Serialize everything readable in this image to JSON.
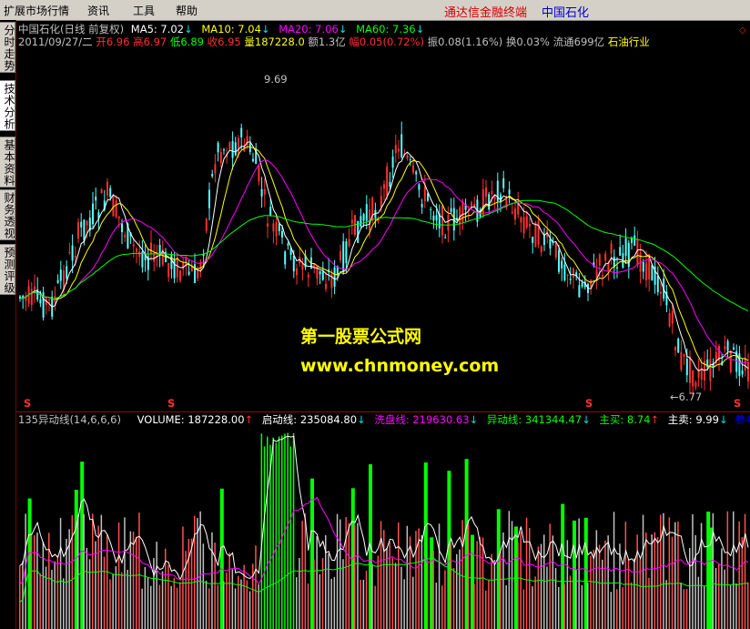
{
  "menu": {
    "items": [
      "扩展市场行情",
      "资讯",
      "工具",
      "帮助"
    ],
    "brand": "通达信金融终端",
    "stock_name": "中国石化"
  },
  "sidebar": {
    "tabs": [
      "分时走势",
      "技术分析",
      "基本资料",
      "财务透视",
      "预测评级"
    ]
  },
  "kline_header": {
    "title": "中国石化(日线 前复权)",
    "ma5_label": "MA5: 7.02",
    "ma10_label": "MA10: 7.04",
    "ma20_label": "MA20: 7.06",
    "ma60_label": "MA60: 7.36",
    "date": "2011/09/27/二",
    "open": "开6.96",
    "high": "高6.97",
    "low": "低6.89",
    "close": "收6.95",
    "volume": "量187228.0",
    "amount": "额1.3亿",
    "change": "幅0.05(0.72%)",
    "amplitude": "振0.08(1.16%)",
    "turnover": "换0.03%",
    "float_shares": "流通699亿",
    "industry": "石油行业"
  },
  "annotations": {
    "high_price": "9.69",
    "low_price": "←6.77",
    "signal_marker": "S"
  },
  "watermark": {
    "line1": "第一股票公式网",
    "line2": "www.chnmoney.com"
  },
  "indicator_header": {
    "name": "135异动线(14,6,6,6)",
    "volume": "VOLUME: 187228.00",
    "qidong": "启动线: 235084.80",
    "xipan": "洗盘线: 219630.63",
    "yidong": "异动线: 341344.47",
    "zhumai": "主买: 8.74",
    "zhumai2": "主卖: 9.99",
    "help": "参考"
  },
  "colors": {
    "ma5": "#ffffff",
    "ma10": "#ffff00",
    "ma20": "#ff00ff",
    "ma60": "#00ff00",
    "up": "#ff3030",
    "down": "#54ffff",
    "brand": "#d40000",
    "stock": "#0000c8"
  }
}
